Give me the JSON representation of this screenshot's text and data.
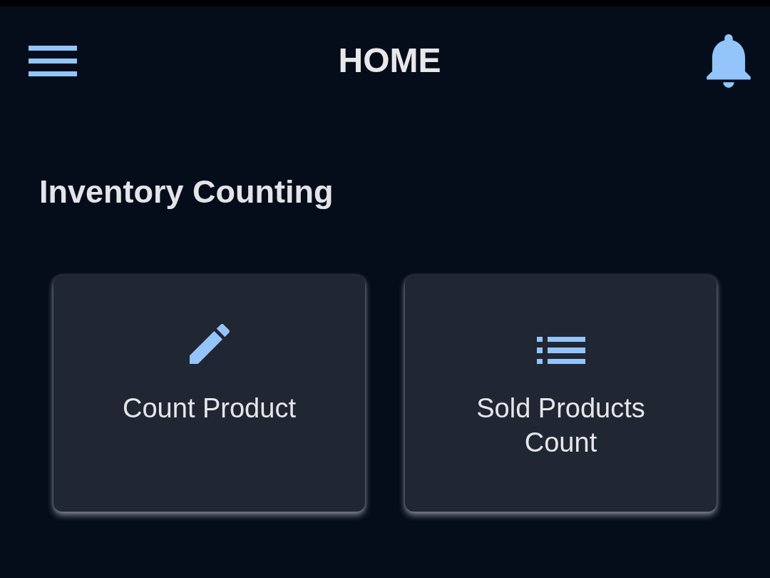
{
  "header": {
    "title": "HOME"
  },
  "section": {
    "title": "Inventory Counting"
  },
  "cards": [
    {
      "kind": "pencil",
      "label": "Count Product"
    },
    {
      "kind": "list",
      "label": "Sold Products Count"
    }
  ]
}
